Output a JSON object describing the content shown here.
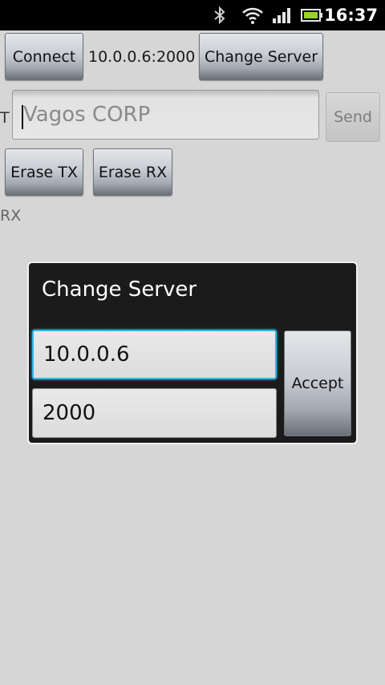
{
  "status_bar": {
    "time": "16:37",
    "icons": [
      "bluetooth-icon",
      "wifi-icon",
      "signal-icon",
      "battery-icon"
    ]
  },
  "toolbar": {
    "connect_label": "Connect",
    "server_address": "10.0.0.6:2000",
    "change_server_label": "Change Server"
  },
  "send_row": {
    "prefix": "T",
    "message_value": "Vagos CORP",
    "send_label": "Send"
  },
  "erase_row": {
    "erase_tx_label": "Erase TX",
    "erase_rx_label": "Erase RX"
  },
  "rx_label": "RX",
  "dialog": {
    "title": "Change Server",
    "ip_value": "10.0.0.6",
    "port_value": "2000",
    "accept_label": "Accept"
  },
  "colors": {
    "focus_accent": "#33b5e5",
    "background": "#d6d6d6",
    "dialog_background": "#1b1b1b"
  }
}
